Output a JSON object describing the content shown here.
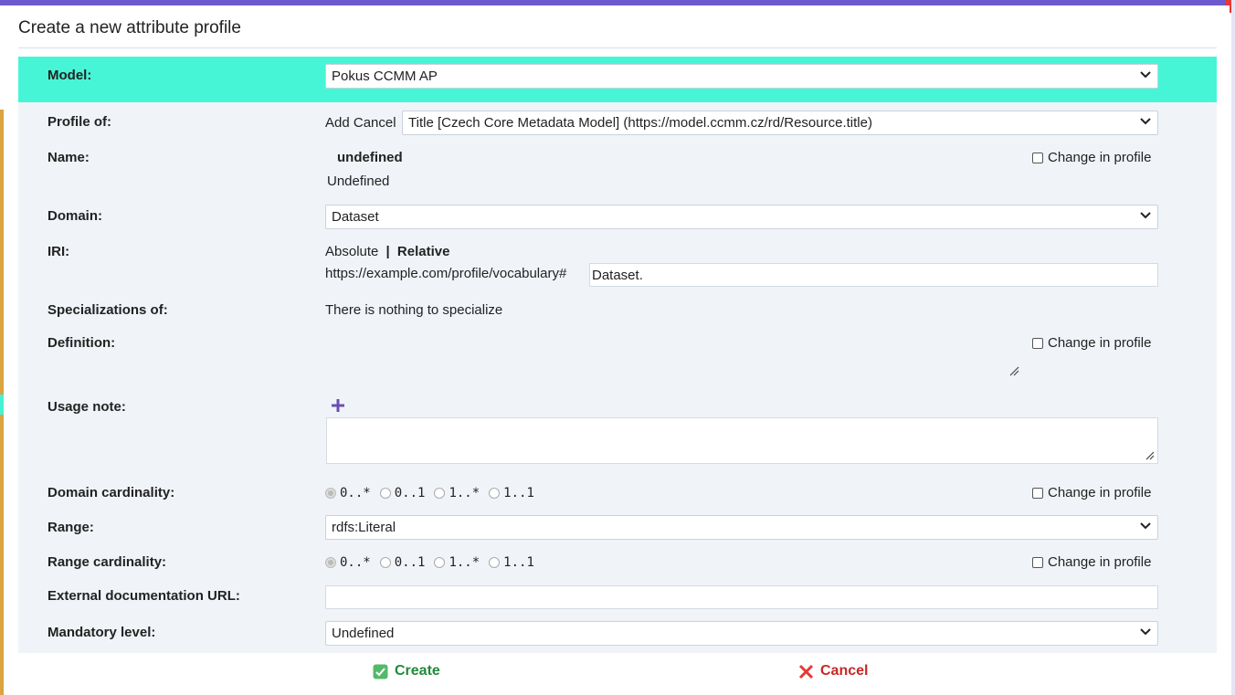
{
  "dialog": {
    "title": "Create a new attribute profile"
  },
  "model": {
    "label": "Model:",
    "value": "Pokus CCMM AP"
  },
  "profile_of": {
    "label": "Profile of:",
    "add_label": "Add",
    "cancel_label": "Cancel",
    "value": "Title [Czech Core Metadata Model] (https://model.ccmm.cz/rd/Resource.title)"
  },
  "name": {
    "label": "Name:",
    "value_bold": "undefined",
    "value": "Undefined",
    "change_label": "Change in profile"
  },
  "domain": {
    "label": "Domain:",
    "value": "Dataset"
  },
  "iri": {
    "label": "IRI:",
    "absolute_label": "Absolute",
    "separator": "|",
    "relative_label": "Relative",
    "prefix": "https://example.com/profile/vocabulary#",
    "value": "Dataset."
  },
  "specializations": {
    "label": "Specializations of:",
    "value": "There is nothing to specialize"
  },
  "definition": {
    "label": "Definition:",
    "change_label": "Change in profile"
  },
  "usage_note": {
    "label": "Usage note:"
  },
  "domain_cardinality": {
    "label": "Domain cardinality:",
    "options": [
      "0..*",
      "0..1",
      "1..*",
      "1..1"
    ],
    "selected": "0..*",
    "change_label": "Change in profile"
  },
  "range": {
    "label": "Range:",
    "value": "rdfs:Literal"
  },
  "range_cardinality": {
    "label": "Range cardinality:",
    "options": [
      "0..*",
      "0..1",
      "1..*",
      "1..1"
    ],
    "selected": "0..*",
    "change_label": "Change in profile"
  },
  "external_doc": {
    "label": "External documentation URL:",
    "value": ""
  },
  "mandatory_level": {
    "label": "Mandatory level:",
    "value": "Undefined"
  },
  "footer": {
    "create_label": "Create",
    "cancel_label": "Cancel"
  },
  "colors": {
    "accent": "#46f5d6",
    "panel": "#f0f4f9",
    "create": "#1f8a3c",
    "cancel": "#c62828",
    "plus": "#6a4fb3"
  },
  "icons": {
    "chevron": "chevron-down-icon",
    "plus": "plus-icon",
    "create": "check-square-icon",
    "cancel": "x-icon"
  }
}
